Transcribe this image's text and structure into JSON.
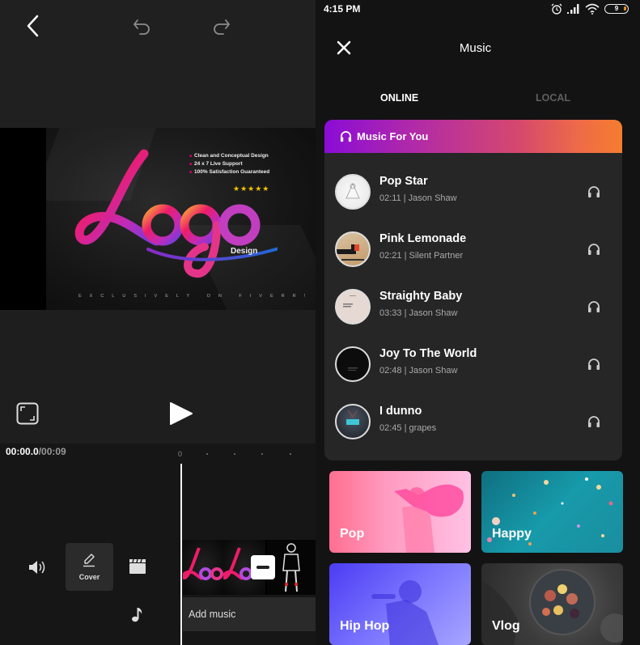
{
  "editor": {
    "toolbar": {
      "back_icon": "chevron-left-icon",
      "undo_icon": "undo-icon",
      "redo_icon": "redo-icon"
    },
    "preview": {
      "bullets": [
        "Clean and Conceptual Design",
        "24 x 7 Live Support",
        "100% Satisfaction Guaranteed"
      ],
      "stars": "★★★★★",
      "logo_text": "Logo",
      "logo_subtext": "Design",
      "tagline": "EXCLUSIVELY ON FIVERR!"
    },
    "controls": {
      "fullscreen_icon": "fullscreen-icon",
      "play_icon": "play-icon"
    },
    "timeline": {
      "current_time": "00:00.0",
      "total_time": "/00:09",
      "ruler_start": "0"
    },
    "tools": {
      "volume_icon": "volume-icon",
      "cover_label": "Cover",
      "cover_icon": "pencil-icon",
      "clapper_icon": "clapperboard-icon",
      "music_icon": "music-note-icon"
    },
    "add_music_label": "Add music"
  },
  "music": {
    "status_bar": {
      "time": "4:15 PM",
      "battery": "9"
    },
    "title": "Music",
    "tabs": [
      {
        "label": "ONLINE",
        "active": true
      },
      {
        "label": "LOCAL",
        "active": false
      }
    ],
    "section": {
      "title": "Music For You",
      "tracks": [
        {
          "title": "Pop Star",
          "duration": "02:11",
          "artist": "Jason Shaw",
          "meta": "02:11 | Jason Shaw"
        },
        {
          "title": "Pink Lemonade",
          "duration": "02:21",
          "artist": "Silent Partner",
          "meta": "02:21 | Silent Partner"
        },
        {
          "title": "Straighty Baby",
          "duration": "03:33",
          "artist": "Jason Shaw",
          "meta": "03:33 | Jason Shaw"
        },
        {
          "title": "Joy To The World",
          "duration": "02:48",
          "artist": "Jason Shaw",
          "meta": "02:48 | Jason Shaw"
        },
        {
          "title": "I dunno",
          "duration": "02:45",
          "artist": "grapes",
          "meta": "02:45 | grapes"
        }
      ]
    },
    "genres": [
      {
        "label": "Pop"
      },
      {
        "label": "Happy"
      },
      {
        "label": "Hip Hop"
      },
      {
        "label": "Vlog"
      }
    ],
    "colors": {
      "header_gradient_start": "#8a0cd6",
      "header_gradient_end": "#f57d2f",
      "tab_active": "#ffffff",
      "tab_inactive": "#5f5f5f"
    }
  }
}
